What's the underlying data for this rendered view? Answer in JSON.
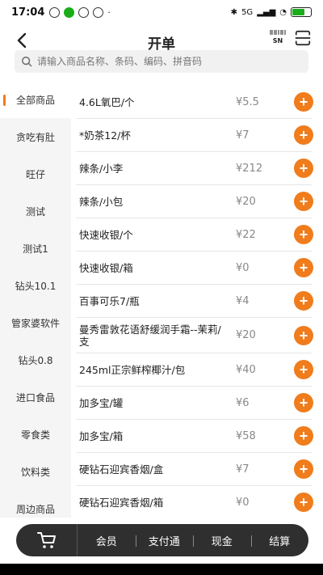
{
  "status": {
    "time": "17:04",
    "network": "5G"
  },
  "header": {
    "title": "开单",
    "sn_label": "SN"
  },
  "search": {
    "placeholder": "请输入商品名称、条码、编码、拼音码"
  },
  "categories": [
    {
      "label": "全部商品",
      "active": true
    },
    {
      "label": "贪吃有肚"
    },
    {
      "label": "旺仔"
    },
    {
      "label": "测试"
    },
    {
      "label": "测试1"
    },
    {
      "label": "钻头10.1"
    },
    {
      "label": "管家婆软件"
    },
    {
      "label": "钻头0.8"
    },
    {
      "label": "进口食品"
    },
    {
      "label": "零食类"
    },
    {
      "label": "饮料类"
    },
    {
      "label": "周边商品"
    }
  ],
  "products": [
    {
      "name": "4.6L氧巴/个",
      "price": "¥5.5"
    },
    {
      "name": "*奶茶12/杯",
      "price": "¥7"
    },
    {
      "name": "辣条/小李",
      "price": "¥212"
    },
    {
      "name": "辣条/小包",
      "price": "¥20"
    },
    {
      "name": "快速收银/个",
      "price": "¥22"
    },
    {
      "name": "快速收银/箱",
      "price": "¥0"
    },
    {
      "name": "百事可乐7/瓶",
      "price": "¥4"
    },
    {
      "name": "曼秀雷敦花语舒缓润手霜--茉莉/支",
      "price": "¥20"
    },
    {
      "name": "245ml正宗鲜榨椰汁/包",
      "price": "¥40"
    },
    {
      "name": "加多宝/罐",
      "price": "¥6"
    },
    {
      "name": "加多宝/箱",
      "price": "¥58"
    },
    {
      "name": "硬钻石迎宾香烟/盒",
      "price": "¥7"
    },
    {
      "name": "硬钻石迎宾香烟/箱",
      "price": "¥0"
    }
  ],
  "bottom_bar": {
    "actions": [
      "会员",
      "支付通",
      "现金",
      "结算"
    ]
  },
  "colors": {
    "accent": "#f07c1c",
    "bottom_bar": "#2f2f2f"
  },
  "icons": {
    "back": "back-arrow-icon",
    "sn": "sn-scan-icon",
    "scan": "scanner-icon",
    "search": "search-icon",
    "cart": "cart-icon",
    "add": "plus-icon"
  }
}
